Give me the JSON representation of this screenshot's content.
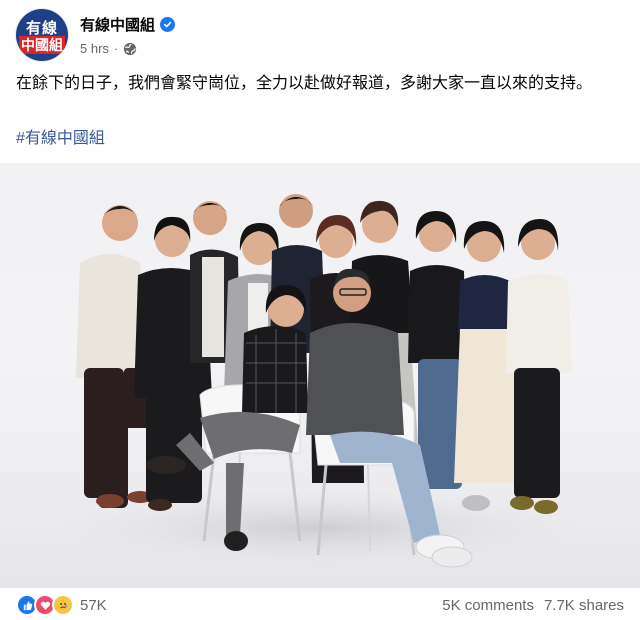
{
  "post": {
    "avatar": {
      "logo_top": "有線",
      "logo_bottom": "中國組",
      "icon": "page-avatar-logo"
    },
    "page_name": "有線中國組",
    "verified_icon": "verified-badge-icon",
    "time": "5 hrs",
    "separator": "·",
    "audience_icon": "globe-icon",
    "text": "在餘下的日子，我們會緊守崗位，全力以赴做好報道，多謝大家一直以來的支持。",
    "hashtag": "#有線中國組"
  },
  "photo": {
    "description_icon": "group-photo",
    "people_count": 11
  },
  "footer": {
    "reaction_icons": [
      "like-icon",
      "love-icon",
      "sad-icon"
    ],
    "reaction_count": "57K",
    "comments": "5K comments",
    "shares": "7.7K shares"
  },
  "colors": {
    "brand_blue": "#1877f2",
    "link_blue": "#385898",
    "secondary_text": "#65676b",
    "logo_navy": "#1f3f86",
    "logo_red": "#d8262b"
  }
}
